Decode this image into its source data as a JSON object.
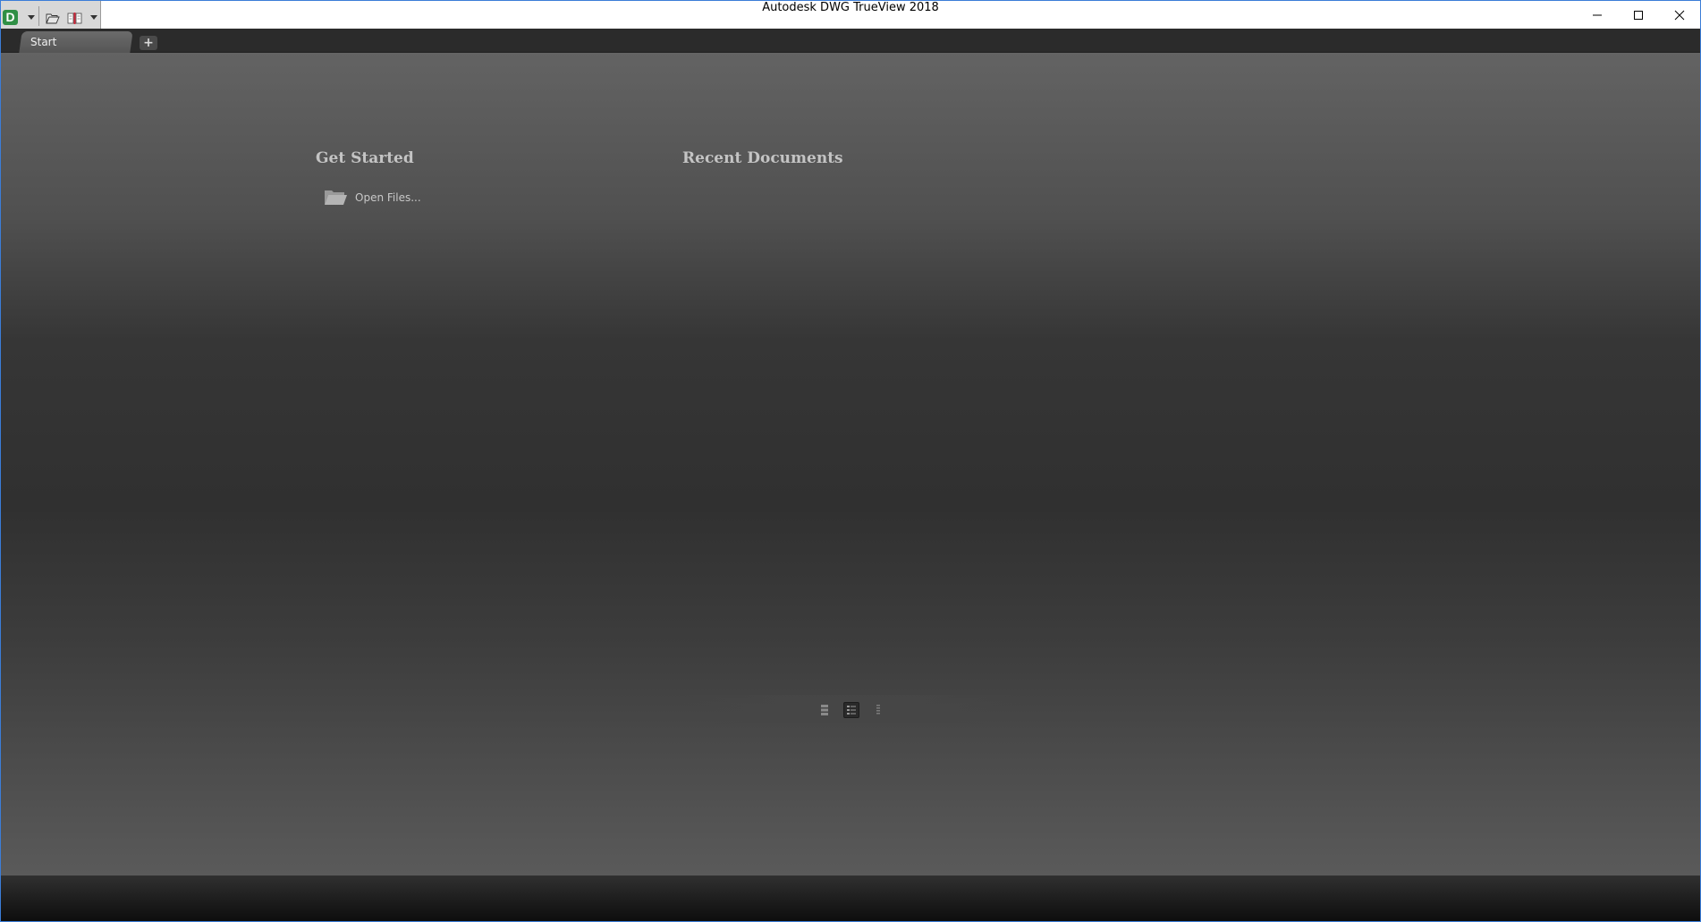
{
  "window": {
    "title": "Autodesk DWG TrueView 2018"
  },
  "quick_access": {
    "app_logo_letter": "D",
    "icons": [
      "app-menu-icon",
      "dropdown-arrow-icon",
      "open-folder-icon",
      "dwg-compare-icon",
      "customize-arrow-icon"
    ]
  },
  "title_controls": {
    "icons": [
      "minimize-icon",
      "maximize-icon",
      "close-icon"
    ]
  },
  "tabs": {
    "items": [
      {
        "label": "Start"
      }
    ],
    "add_label": "+"
  },
  "start_page": {
    "get_started": {
      "heading": "Get Started",
      "open_files_label": "Open Files..."
    },
    "recent_documents": {
      "heading": "Recent Documents"
    },
    "view_options": {
      "icons": [
        "large-icons-view-icon",
        "list-view-icon",
        "small-list-view-icon"
      ],
      "selected": "list-view-icon"
    }
  },
  "colors": {
    "accent_green": "#2f8f45",
    "window_border": "#3b7dd8"
  }
}
